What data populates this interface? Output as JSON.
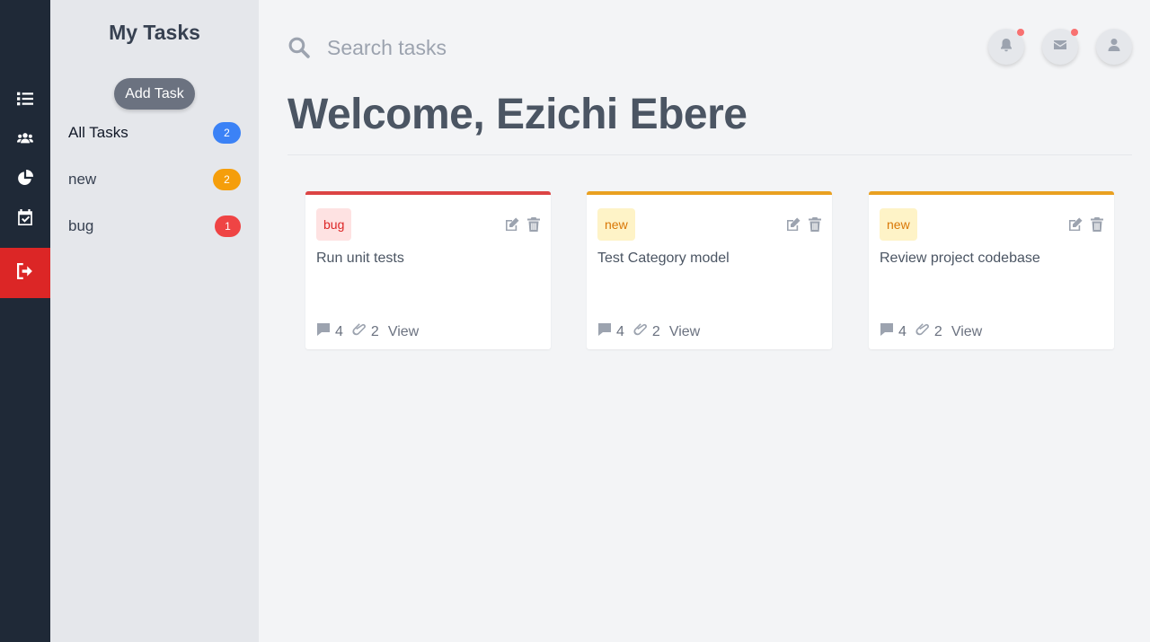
{
  "rail": {
    "items": [
      {
        "icon": "list-icon"
      },
      {
        "icon": "users-icon"
      },
      {
        "icon": "pie-chart-icon"
      },
      {
        "icon": "calendar-check-icon"
      },
      {
        "icon": "sign-out-icon"
      }
    ]
  },
  "sidebar": {
    "title": "My Tasks",
    "add_label": "Add Task",
    "categories": [
      {
        "label": "All Tasks",
        "count": "2",
        "color": "#3b82f6"
      },
      {
        "label": "new",
        "count": "2",
        "color": "#f59e0b"
      },
      {
        "label": "bug",
        "count": "1",
        "color": "#ef4444"
      }
    ]
  },
  "search": {
    "placeholder": "Search tasks",
    "value": ""
  },
  "header": {
    "buttons": [
      {
        "icon": "bell-icon",
        "has_dot": true
      },
      {
        "icon": "envelope-icon",
        "has_dot": true
      },
      {
        "icon": "user-icon",
        "has_dot": false
      }
    ]
  },
  "welcome": {
    "greeting": "Welcome,",
    "name": "Ezichi Ebere"
  },
  "tasks": [
    {
      "tag": "bug",
      "title": "Run unit tests",
      "comments": "4",
      "attachments": "2",
      "view_label": "View",
      "accent": "#dc4444"
    },
    {
      "tag": "new",
      "title": "Test Category model",
      "comments": "4",
      "attachments": "2",
      "view_label": "View",
      "accent": "#e9a020"
    },
    {
      "tag": "new",
      "title": "Review project codebase",
      "comments": "4",
      "attachments": "2",
      "view_label": "View",
      "accent": "#e9a020"
    }
  ]
}
